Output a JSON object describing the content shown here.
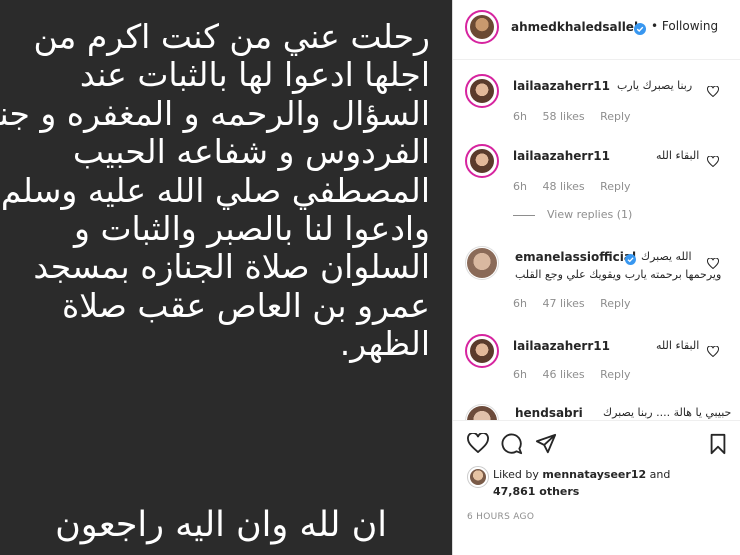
{
  "post_text": {
    "lines": [
      "رحلت عني من كنت اكرم من",
      "اجلها ادعوا لها بالثبات عند",
      "السؤال والرحمه و المغفره و جنة",
      "الفردوس و شفاعه الحبيب",
      "المصطفي صلي الله عليه وسلم",
      "وادعوا لنا بالصبر والثبات و",
      "السلوان صلاة الجنازه بمسجد",
      "عمرو بن العاص عقب صلاة",
      "الظهر."
    ],
    "footer": "ان لله وان اليه راجعون"
  },
  "header": {
    "username": "ahmedkhaledsalleh",
    "follow_status": "• Following"
  },
  "comments": [
    {
      "username": "lailaazaherr11",
      "text": "ربنا يصبرك يارب",
      "time": "6h",
      "likes": "58 likes",
      "reply": "Reply"
    },
    {
      "username": "lailaazaherr11",
      "text": "البقاء الله",
      "time": "6h",
      "likes": "48 likes",
      "reply": "Reply"
    },
    {
      "username": "emanelassiofficial",
      "text": "الله يصبرك",
      "text2": "ويرحمها برحمته يارب ويقويك علي وجع القلب",
      "time": "6h",
      "likes": "47 likes",
      "reply": "Reply"
    },
    {
      "username": "lailaazaherr11",
      "text": "البقاء الله",
      "time": "6h",
      "likes": "46 likes",
      "reply": "Reply"
    },
    {
      "username": "hendsabri",
      "text": "حبيبي يا هالة .... ربنا يصبرك"
    }
  ],
  "view_replies": "View replies (1)",
  "likes": {
    "prefix": "Liked by",
    "user": "mennatayseer12",
    "and": "and",
    "count": "47,861 others"
  },
  "timestamp": "6 HOURS AGO",
  "colors": {
    "post_bg": "#2b2b2b",
    "verified": "#3897f0",
    "muted": "#8e8e8e",
    "story_ring": "#d6249f"
  },
  "icons": [
    "verified-badge-icon",
    "heart-icon",
    "comment-icon",
    "share-icon",
    "bookmark-icon"
  ]
}
